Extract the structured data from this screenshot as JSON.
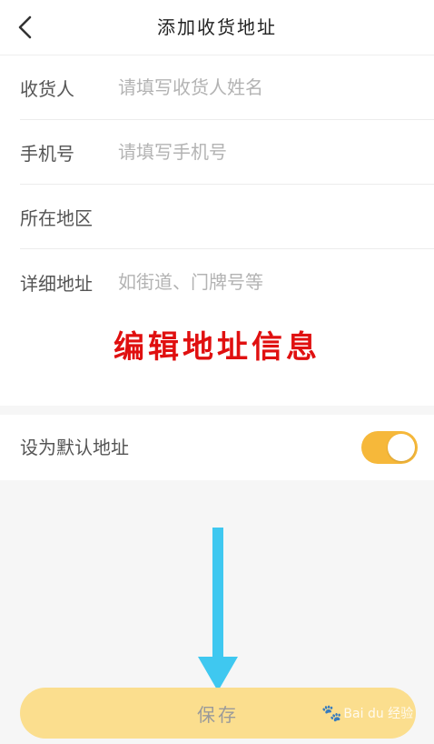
{
  "header": {
    "back_icon": "chevron-left-icon",
    "title": "添加收货地址"
  },
  "form": {
    "receiver": {
      "label": "收货人",
      "placeholder": "请填写收货人姓名"
    },
    "phone": {
      "label": "手机号",
      "placeholder": "请填写手机号"
    },
    "region": {
      "label": "所在地区"
    },
    "address": {
      "label": "详细地址",
      "placeholder": "如街道、门牌号等"
    }
  },
  "annotation": {
    "text": "编辑地址信息",
    "color": "#e01010"
  },
  "default_address": {
    "label": "设为默认地址",
    "enabled": true,
    "accent": "#f6b83a"
  },
  "save_button": {
    "label": "保存",
    "color": "#fbde8e"
  },
  "watermark": {
    "text": "Bai du 经验"
  }
}
